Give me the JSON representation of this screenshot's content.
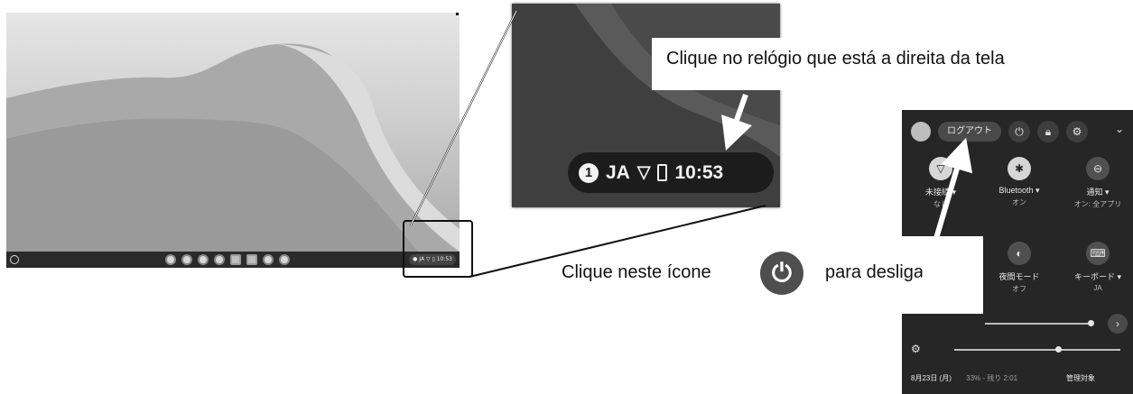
{
  "tray": {
    "notification_count": "1",
    "ime": "JA",
    "wifi_glyph": "▽",
    "time": "10:53",
    "small_text": "JA ▽ ▯ 10:53"
  },
  "callouts": {
    "top": "Clique no relógio que está a direita da tela",
    "bottom_before": "Clique neste ícone",
    "bottom_after": "para desligar"
  },
  "quick_settings": {
    "logout": "ログアウト",
    "tiles": [
      {
        "label": "未接続 ▾",
        "sub": "なし",
        "icon": "wifi-icon"
      },
      {
        "label": "Bluetooth ▾",
        "sub": "オン",
        "icon": "bluetooth-icon"
      },
      {
        "label": "通知 ▾",
        "sub": "オン: 全アプリ",
        "icon": "notifications-icon"
      },
      {
        "label": "夜間モード",
        "sub": "オフ",
        "icon": "night-light-icon"
      },
      {
        "label": "キーボード ▾",
        "sub": "JA",
        "icon": "keyboard-icon"
      }
    ],
    "footer": {
      "date": "8月23日 (月)",
      "battery": "33% - 残り 2:01",
      "managed": "管理対象"
    }
  },
  "colors": {
    "panel_bg": "#262626",
    "tray_bg": "#1c1c1c",
    "power_button": "#4e4e4e"
  }
}
